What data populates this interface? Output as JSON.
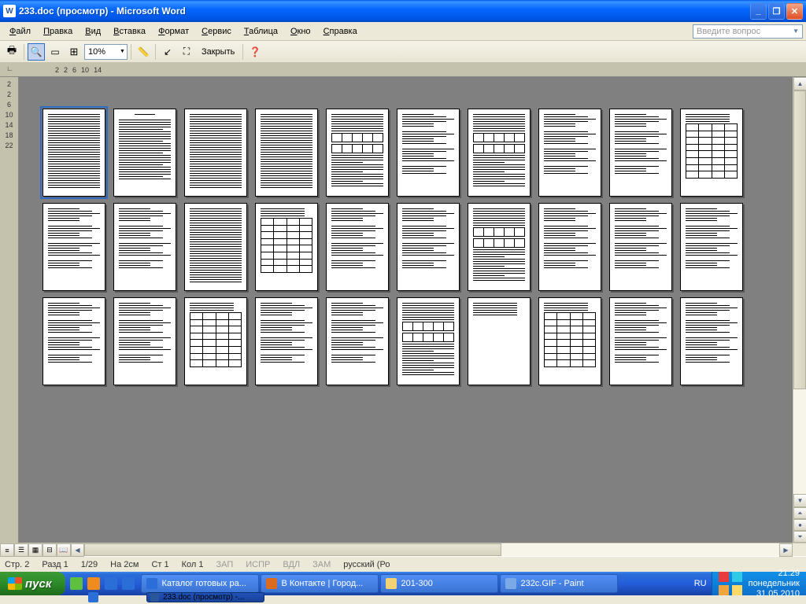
{
  "titlebar": {
    "app_icon_letter": "W",
    "title": "233.doc (просмотр) - Microsoft Word"
  },
  "menubar": {
    "items": [
      "Файл",
      "Правка",
      "Вид",
      "Вставка",
      "Формат",
      "Сервис",
      "Таблица",
      "Окно",
      "Справка"
    ],
    "help_placeholder": "Введите вопрос"
  },
  "toolbar": {
    "zoom": "10%",
    "close_label": "Закрыть"
  },
  "ruler_h": {
    "marks": [
      "2",
      "2",
      "6",
      "10",
      "14"
    ]
  },
  "ruler_v": {
    "marks": [
      "2",
      "2",
      "6",
      "10",
      "14",
      "18",
      "22"
    ]
  },
  "document": {
    "total_pages": 30,
    "selected_page": 1
  },
  "statusbar": {
    "page": "Стр. 2",
    "section": "Разд 1",
    "pages": "1/29",
    "at": "На 2см",
    "line": "Ст 1",
    "col": "Кол 1",
    "modes": [
      "ЗАП",
      "ИСПР",
      "ВДЛ",
      "ЗАМ"
    ],
    "lang": "русский (Ро"
  },
  "taskbar": {
    "start": "пуск",
    "lang": "RU",
    "tasks": [
      {
        "label": "Каталог готовых ра...",
        "color": "#2b6ed8"
      },
      {
        "label": "В Контакте | Город...",
        "color": "#db6b1f"
      },
      {
        "label": "201-300",
        "color": "#f2d274"
      },
      {
        "label": "232c.GIF - Paint",
        "color": "#7aa9e8"
      }
    ],
    "tasks_row2": [
      {
        "label": "233.doc (просмотр) -...",
        "color": "#2b579a"
      }
    ],
    "clock": {
      "time": "21:29",
      "day": "понедельник",
      "date": "31.05.2010"
    }
  }
}
